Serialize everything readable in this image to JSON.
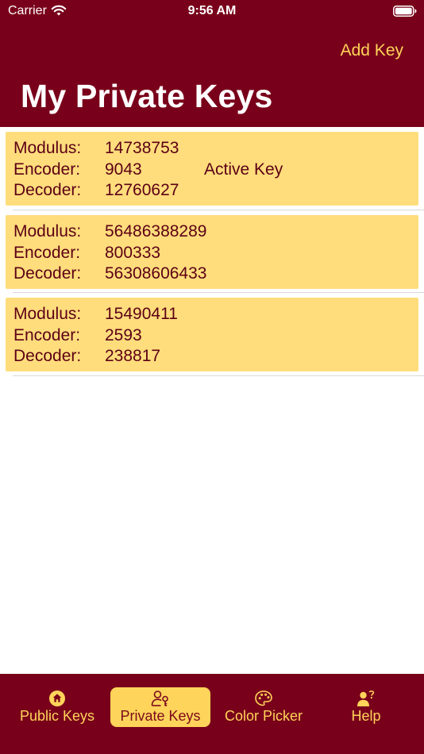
{
  "status_bar": {
    "carrier": "Carrier",
    "time": "9:56 AM"
  },
  "nav": {
    "add_key_label": "Add Key",
    "title": "My Private Keys"
  },
  "labels": {
    "modulus": "Modulus:",
    "encoder": "Encoder:",
    "decoder": "Decoder:"
  },
  "keys": [
    {
      "modulus": "14738753",
      "encoder": "9043",
      "decoder": "12760627",
      "badge": "Active Key"
    },
    {
      "modulus": "56486388289",
      "encoder": "800333",
      "decoder": "56308606433"
    },
    {
      "modulus": "15490411",
      "encoder": "2593",
      "decoder": "238817"
    }
  ],
  "tabs": [
    {
      "label": "Public Keys",
      "icon": "house-icon"
    },
    {
      "label": "Private Keys",
      "icon": "person-key-icon",
      "selected": true
    },
    {
      "label": "Color Picker",
      "icon": "palette-icon"
    },
    {
      "label": "Help",
      "icon": "person-question-icon"
    }
  ],
  "colors": {
    "nav_background": "#79001a",
    "accent": "#ffd45a",
    "card_background": "#ffdd7c",
    "card_text": "#5c0015"
  }
}
